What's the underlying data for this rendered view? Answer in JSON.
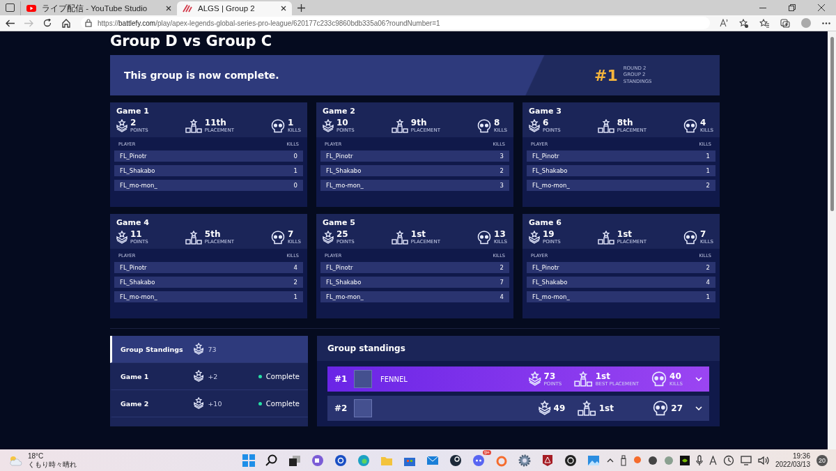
{
  "browser": {
    "tabs": [
      {
        "title": "ライブ配信 - YouTube Studio",
        "kind": "youtube",
        "selected": false
      },
      {
        "title": "ALGS | Group 2",
        "kind": "algs",
        "selected": true
      }
    ],
    "url": {
      "scheme": "https://",
      "host": "battlefy.com",
      "path": "/play/apex-legends-global-series-pro-league/620177c233c9860bdb335a06?roundNumber=1"
    }
  },
  "page": {
    "title": "Group D vs Group C",
    "banner": {
      "message": "This group is now complete.",
      "rank": "#1",
      "details": [
        "ROUND 2",
        "GROUP 2",
        "STANDINGS"
      ]
    }
  },
  "games": [
    {
      "title": "Game 1",
      "points": "2",
      "points_label": "POINTS",
      "placement": "11th",
      "placement_label": "PLACEMENT",
      "kills": "1",
      "kills_label": "KILLS",
      "columns": [
        "PLAYER",
        "KILLS"
      ],
      "players": [
        {
          "name": "FL_Pinotr",
          "kills": "0"
        },
        {
          "name": "FL_Shakabo",
          "kills": "1"
        },
        {
          "name": "FL_mo-mon_",
          "kills": "0"
        }
      ]
    },
    {
      "title": "Game 2",
      "points": "10",
      "points_label": "POINTS",
      "placement": "9th",
      "placement_label": "PLACEMENT",
      "kills": "8",
      "kills_label": "KILLS",
      "columns": [
        "PLAYER",
        "KILLS"
      ],
      "players": [
        {
          "name": "FL_Pinotr",
          "kills": "3"
        },
        {
          "name": "FL_Shakabo",
          "kills": "2"
        },
        {
          "name": "FL_mo-mon_",
          "kills": "3"
        }
      ]
    },
    {
      "title": "Game 3",
      "points": "6",
      "points_label": "POINTS",
      "placement": "8th",
      "placement_label": "PLACEMENT",
      "kills": "4",
      "kills_label": "KILLS",
      "columns": [
        "PLAYER",
        "KILLS"
      ],
      "players": [
        {
          "name": "FL_Pinotr",
          "kills": "1"
        },
        {
          "name": "FL_Shakabo",
          "kills": "1"
        },
        {
          "name": "FL_mo-mon_",
          "kills": "2"
        }
      ]
    },
    {
      "title": "Game 4",
      "points": "11",
      "points_label": "POINTS",
      "placement": "5th",
      "placement_label": "PLACEMENT",
      "kills": "7",
      "kills_label": "KILLS",
      "columns": [
        "PLAYER",
        "KILLS"
      ],
      "players": [
        {
          "name": "FL_Pinotr",
          "kills": "4"
        },
        {
          "name": "FL_Shakabo",
          "kills": "2"
        },
        {
          "name": "FL_mo-mon_",
          "kills": "1"
        }
      ]
    },
    {
      "title": "Game 5",
      "points": "25",
      "points_label": "POINTS",
      "placement": "1st",
      "placement_label": "PLACEMENT",
      "kills": "13",
      "kills_label": "KILLS",
      "columns": [
        "PLAYER",
        "KILLS"
      ],
      "players": [
        {
          "name": "FL_Pinotr",
          "kills": "2"
        },
        {
          "name": "FL_Shakabo",
          "kills": "7"
        },
        {
          "name": "FL_mo-mon_",
          "kills": "4"
        }
      ]
    },
    {
      "title": "Game 6",
      "points": "19",
      "points_label": "POINTS",
      "placement": "1st",
      "placement_label": "PLACEMENT",
      "kills": "7",
      "kills_label": "KILLS",
      "columns": [
        "PLAYER",
        "KILLS"
      ],
      "players": [
        {
          "name": "FL_Pinotr",
          "kills": "2"
        },
        {
          "name": "FL_Shakabo",
          "kills": "4"
        },
        {
          "name": "FL_mo-mon_",
          "kills": "1"
        }
      ]
    }
  ],
  "sidebar": {
    "items": [
      {
        "label": "Group Standings",
        "points": "73",
        "selected": true
      },
      {
        "label": "Game 1",
        "points": "+2",
        "status": "Complete",
        "selected": false
      },
      {
        "label": "Game 2",
        "points": "+10",
        "status": "Complete",
        "selected": false
      }
    ]
  },
  "standings": {
    "title": "Group standings",
    "rows": [
      {
        "rank": "#1",
        "team": "FENNEL",
        "points": "73",
        "points_label": "POINTS",
        "placement": "1st",
        "placement_label": "BEST PLACEMENT",
        "kills": "40",
        "kills_label": "KILLS",
        "highlighted": true
      },
      {
        "rank": "#2",
        "points": "49",
        "placement": "1st",
        "kills": "27",
        "highlighted": false
      }
    ]
  },
  "taskbar": {
    "weather": {
      "temperature": "18°C",
      "condition": "くもり時々晴れ"
    },
    "chat_badge": "9+",
    "time": "19:36",
    "date": "2022/03/13",
    "notifications": "20"
  }
}
